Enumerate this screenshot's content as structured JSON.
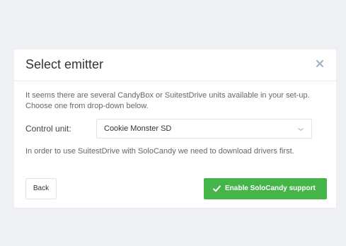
{
  "dialog": {
    "title": "Select emitter",
    "intro": "It seems there are several CandyBox or SuitestDrive units available in your set-up. Choose one from drop-down below.",
    "control_unit": {
      "label": "Control unit:",
      "selected": "Cookie Monster SD"
    },
    "note": "In order to use SuitestDrive with SoloCandy we need to download drivers first.",
    "back_label": "Back",
    "primary_label": "Enable SoloCandy support",
    "icons": {
      "close": "close-icon",
      "chevron": "chevron-down-icon",
      "check": "check-icon"
    },
    "colors": {
      "primary": "#45b54a",
      "background": "#eef0f3",
      "close_icon": "#9fb4c8"
    }
  }
}
